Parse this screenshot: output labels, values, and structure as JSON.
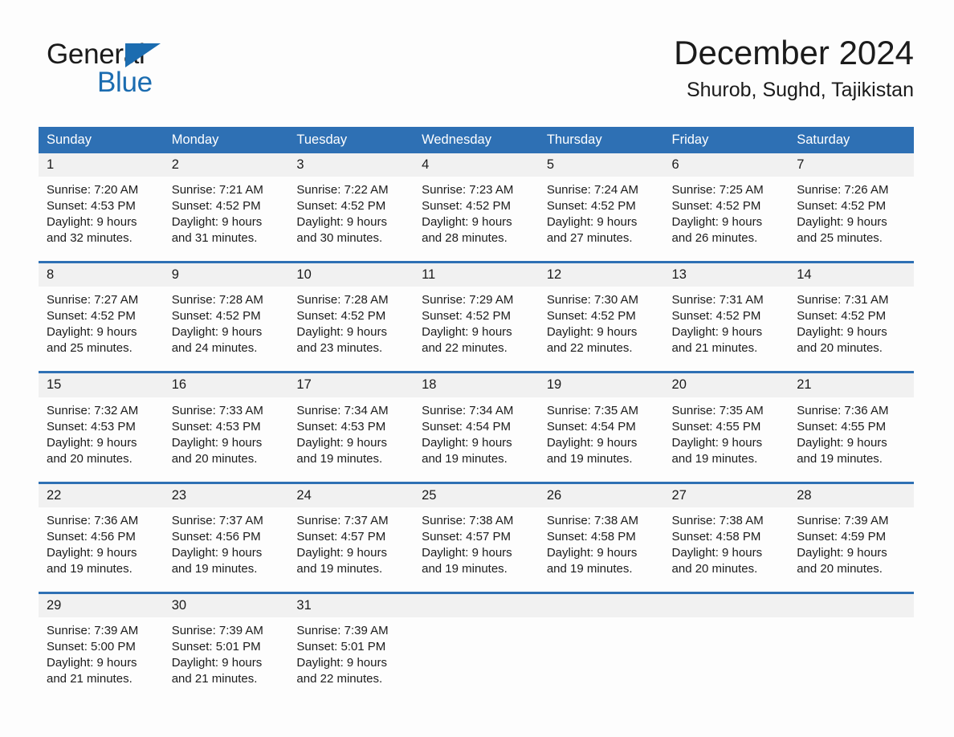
{
  "brand": {
    "name_part1": "General",
    "name_part2": "Blue",
    "triangle_icon": "blue-triangle-icon",
    "color_primary": "#1b6cb0"
  },
  "header": {
    "title": "December 2024",
    "subtitle": "Shurob, Sughd, Tajikistan"
  },
  "calendar": {
    "header_bg": "#2e70b4",
    "daynum_bg": "#f1f1f1",
    "weekday_headers": [
      "Sunday",
      "Monday",
      "Tuesday",
      "Wednesday",
      "Thursday",
      "Friday",
      "Saturday"
    ],
    "weeks": [
      [
        {
          "day": "1",
          "sunrise": "Sunrise: 7:20 AM",
          "sunset": "Sunset: 4:53 PM",
          "daylight1": "Daylight: 9 hours",
          "daylight2": "and 32 minutes."
        },
        {
          "day": "2",
          "sunrise": "Sunrise: 7:21 AM",
          "sunset": "Sunset: 4:52 PM",
          "daylight1": "Daylight: 9 hours",
          "daylight2": "and 31 minutes."
        },
        {
          "day": "3",
          "sunrise": "Sunrise: 7:22 AM",
          "sunset": "Sunset: 4:52 PM",
          "daylight1": "Daylight: 9 hours",
          "daylight2": "and 30 minutes."
        },
        {
          "day": "4",
          "sunrise": "Sunrise: 7:23 AM",
          "sunset": "Sunset: 4:52 PM",
          "daylight1": "Daylight: 9 hours",
          "daylight2": "and 28 minutes."
        },
        {
          "day": "5",
          "sunrise": "Sunrise: 7:24 AM",
          "sunset": "Sunset: 4:52 PM",
          "daylight1": "Daylight: 9 hours",
          "daylight2": "and 27 minutes."
        },
        {
          "day": "6",
          "sunrise": "Sunrise: 7:25 AM",
          "sunset": "Sunset: 4:52 PM",
          "daylight1": "Daylight: 9 hours",
          "daylight2": "and 26 minutes."
        },
        {
          "day": "7",
          "sunrise": "Sunrise: 7:26 AM",
          "sunset": "Sunset: 4:52 PM",
          "daylight1": "Daylight: 9 hours",
          "daylight2": "and 25 minutes."
        }
      ],
      [
        {
          "day": "8",
          "sunrise": "Sunrise: 7:27 AM",
          "sunset": "Sunset: 4:52 PM",
          "daylight1": "Daylight: 9 hours",
          "daylight2": "and 25 minutes."
        },
        {
          "day": "9",
          "sunrise": "Sunrise: 7:28 AM",
          "sunset": "Sunset: 4:52 PM",
          "daylight1": "Daylight: 9 hours",
          "daylight2": "and 24 minutes."
        },
        {
          "day": "10",
          "sunrise": "Sunrise: 7:28 AM",
          "sunset": "Sunset: 4:52 PM",
          "daylight1": "Daylight: 9 hours",
          "daylight2": "and 23 minutes."
        },
        {
          "day": "11",
          "sunrise": "Sunrise: 7:29 AM",
          "sunset": "Sunset: 4:52 PM",
          "daylight1": "Daylight: 9 hours",
          "daylight2": "and 22 minutes."
        },
        {
          "day": "12",
          "sunrise": "Sunrise: 7:30 AM",
          "sunset": "Sunset: 4:52 PM",
          "daylight1": "Daylight: 9 hours",
          "daylight2": "and 22 minutes."
        },
        {
          "day": "13",
          "sunrise": "Sunrise: 7:31 AM",
          "sunset": "Sunset: 4:52 PM",
          "daylight1": "Daylight: 9 hours",
          "daylight2": "and 21 minutes."
        },
        {
          "day": "14",
          "sunrise": "Sunrise: 7:31 AM",
          "sunset": "Sunset: 4:52 PM",
          "daylight1": "Daylight: 9 hours",
          "daylight2": "and 20 minutes."
        }
      ],
      [
        {
          "day": "15",
          "sunrise": "Sunrise: 7:32 AM",
          "sunset": "Sunset: 4:53 PM",
          "daylight1": "Daylight: 9 hours",
          "daylight2": "and 20 minutes."
        },
        {
          "day": "16",
          "sunrise": "Sunrise: 7:33 AM",
          "sunset": "Sunset: 4:53 PM",
          "daylight1": "Daylight: 9 hours",
          "daylight2": "and 20 minutes."
        },
        {
          "day": "17",
          "sunrise": "Sunrise: 7:34 AM",
          "sunset": "Sunset: 4:53 PM",
          "daylight1": "Daylight: 9 hours",
          "daylight2": "and 19 minutes."
        },
        {
          "day": "18",
          "sunrise": "Sunrise: 7:34 AM",
          "sunset": "Sunset: 4:54 PM",
          "daylight1": "Daylight: 9 hours",
          "daylight2": "and 19 minutes."
        },
        {
          "day": "19",
          "sunrise": "Sunrise: 7:35 AM",
          "sunset": "Sunset: 4:54 PM",
          "daylight1": "Daylight: 9 hours",
          "daylight2": "and 19 minutes."
        },
        {
          "day": "20",
          "sunrise": "Sunrise: 7:35 AM",
          "sunset": "Sunset: 4:55 PM",
          "daylight1": "Daylight: 9 hours",
          "daylight2": "and 19 minutes."
        },
        {
          "day": "21",
          "sunrise": "Sunrise: 7:36 AM",
          "sunset": "Sunset: 4:55 PM",
          "daylight1": "Daylight: 9 hours",
          "daylight2": "and 19 minutes."
        }
      ],
      [
        {
          "day": "22",
          "sunrise": "Sunrise: 7:36 AM",
          "sunset": "Sunset: 4:56 PM",
          "daylight1": "Daylight: 9 hours",
          "daylight2": "and 19 minutes."
        },
        {
          "day": "23",
          "sunrise": "Sunrise: 7:37 AM",
          "sunset": "Sunset: 4:56 PM",
          "daylight1": "Daylight: 9 hours",
          "daylight2": "and 19 minutes."
        },
        {
          "day": "24",
          "sunrise": "Sunrise: 7:37 AM",
          "sunset": "Sunset: 4:57 PM",
          "daylight1": "Daylight: 9 hours",
          "daylight2": "and 19 minutes."
        },
        {
          "day": "25",
          "sunrise": "Sunrise: 7:38 AM",
          "sunset": "Sunset: 4:57 PM",
          "daylight1": "Daylight: 9 hours",
          "daylight2": "and 19 minutes."
        },
        {
          "day": "26",
          "sunrise": "Sunrise: 7:38 AM",
          "sunset": "Sunset: 4:58 PM",
          "daylight1": "Daylight: 9 hours",
          "daylight2": "and 19 minutes."
        },
        {
          "day": "27",
          "sunrise": "Sunrise: 7:38 AM",
          "sunset": "Sunset: 4:58 PM",
          "daylight1": "Daylight: 9 hours",
          "daylight2": "and 20 minutes."
        },
        {
          "day": "28",
          "sunrise": "Sunrise: 7:39 AM",
          "sunset": "Sunset: 4:59 PM",
          "daylight1": "Daylight: 9 hours",
          "daylight2": "and 20 minutes."
        }
      ],
      [
        {
          "day": "29",
          "sunrise": "Sunrise: 7:39 AM",
          "sunset": "Sunset: 5:00 PM",
          "daylight1": "Daylight: 9 hours",
          "daylight2": "and 21 minutes."
        },
        {
          "day": "30",
          "sunrise": "Sunrise: 7:39 AM",
          "sunset": "Sunset: 5:01 PM",
          "daylight1": "Daylight: 9 hours",
          "daylight2": "and 21 minutes."
        },
        {
          "day": "31",
          "sunrise": "Sunrise: 7:39 AM",
          "sunset": "Sunset: 5:01 PM",
          "daylight1": "Daylight: 9 hours",
          "daylight2": "and 22 minutes."
        },
        {
          "day": "",
          "sunrise": "",
          "sunset": "",
          "daylight1": "",
          "daylight2": ""
        },
        {
          "day": "",
          "sunrise": "",
          "sunset": "",
          "daylight1": "",
          "daylight2": ""
        },
        {
          "day": "",
          "sunrise": "",
          "sunset": "",
          "daylight1": "",
          "daylight2": ""
        },
        {
          "day": "",
          "sunrise": "",
          "sunset": "",
          "daylight1": "",
          "daylight2": ""
        }
      ]
    ]
  }
}
